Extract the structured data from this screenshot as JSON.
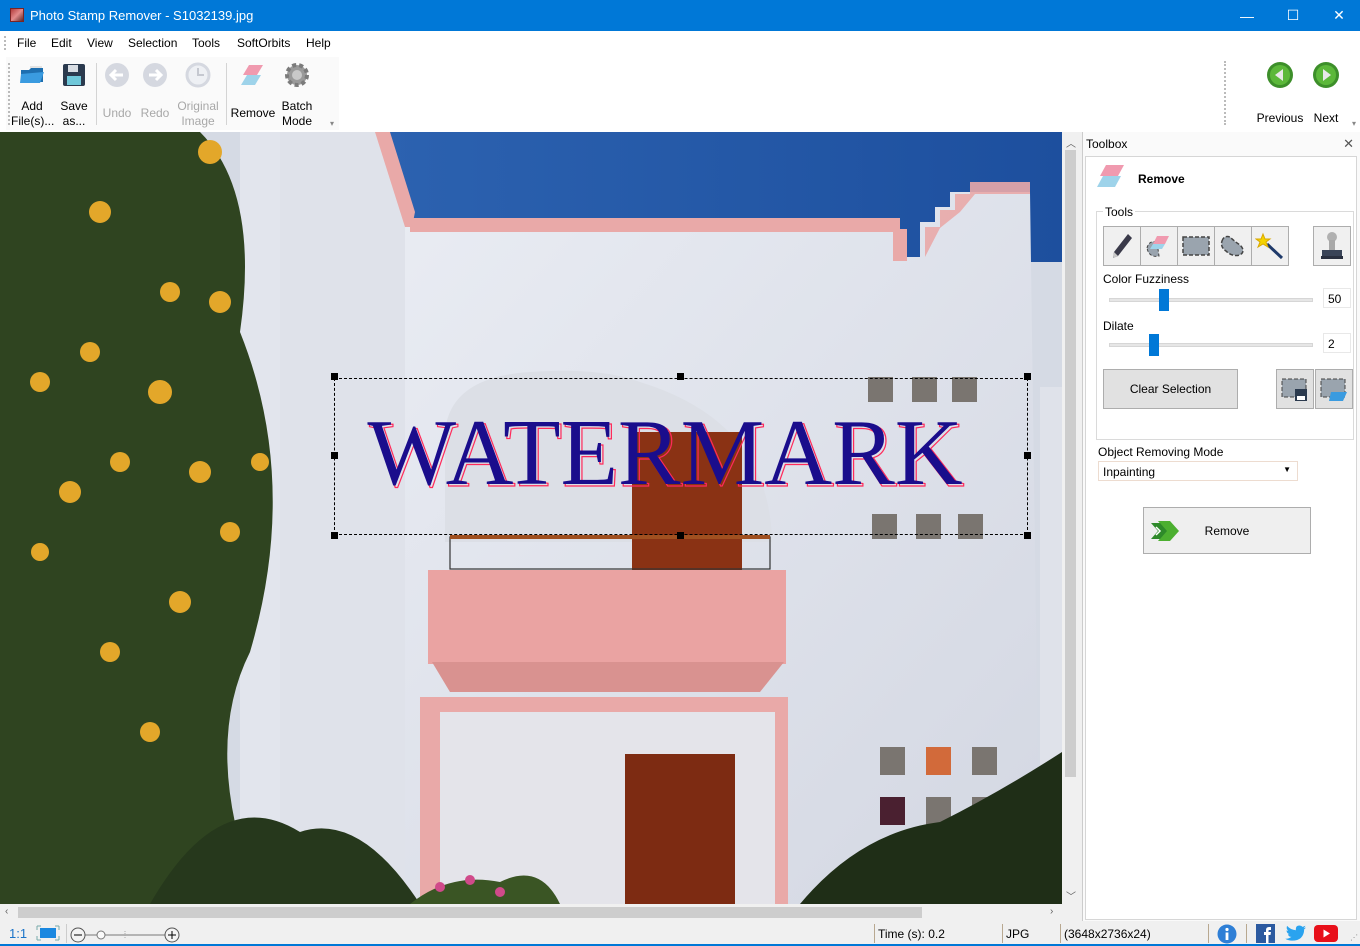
{
  "window": {
    "title": "Photo Stamp Remover - S1032139.jpg",
    "controls": {
      "minimize": "—",
      "maximize": "☐",
      "close": "✕"
    }
  },
  "menu": [
    "File",
    "Edit",
    "View",
    "Selection",
    "Tools",
    "SoftOrbits",
    "Help"
  ],
  "toolbar": {
    "add_files": {
      "line1": "Add",
      "line2": "File(s)...",
      "icon": "open-folder-icon"
    },
    "save_as": {
      "line1": "Save",
      "line2": "as...",
      "icon": "floppy-disk-icon"
    },
    "undo": {
      "label": "Undo",
      "icon": "undo-arrow-icon",
      "enabled": false
    },
    "redo": {
      "label": "Redo",
      "icon": "redo-arrow-icon",
      "enabled": false
    },
    "original_image": {
      "line1": "Original",
      "line2": "Image",
      "icon": "clock-history-icon",
      "enabled": false
    },
    "remove": {
      "label": "Remove",
      "icon": "eraser-icon"
    },
    "batch_mode": {
      "line1": "Batch",
      "line2": "Mode",
      "icon": "gear-icon"
    },
    "previous": {
      "label": "Previous",
      "icon": "green-left-arrow-icon"
    },
    "next": {
      "label": "Next",
      "icon": "green-right-arrow-icon"
    }
  },
  "canvas": {
    "watermark_text": "WATERMARK",
    "watermark_color": "#1a0d8c",
    "selection": "rectangle around watermark"
  },
  "toolbox": {
    "header": "Toolbox",
    "close": "✕",
    "section_title": "Remove",
    "tools_group_label": "Tools",
    "tools": [
      {
        "name": "pencil-tool",
        "icon": "pencil-icon"
      },
      {
        "name": "eraser-selection-tool",
        "icon": "eraser-lasso-icon"
      },
      {
        "name": "rectangle-selection-tool",
        "icon": "dashed-rectangle-icon"
      },
      {
        "name": "lasso-tool",
        "icon": "dashed-lasso-icon"
      },
      {
        "name": "magic-wand-tool",
        "icon": "magic-wand-icon"
      }
    ],
    "stamp_tool": {
      "icon": "stamp-icon"
    },
    "color_fuzziness": {
      "label": "Color Fuzziness",
      "value": "50",
      "fraction": 0.25
    },
    "dilate": {
      "label": "Dilate",
      "value": "2",
      "fraction": 0.2
    },
    "clear_selection_label": "Clear Selection",
    "save_selection_icon": "save-selection-icon",
    "load_selection_icon": "load-selection-icon",
    "mode_label": "Object Removing Mode",
    "mode_value": "Inpainting",
    "remove_button_label": "Remove"
  },
  "statusbar": {
    "zoom_1to1": "1:1",
    "time": "Time (s): 0.2",
    "format": "JPG",
    "dimensions": "(3648x2736x24)"
  },
  "colors": {
    "accent": "#0078d7",
    "slider": "#0078d7",
    "nav_green": "#4caf30"
  }
}
